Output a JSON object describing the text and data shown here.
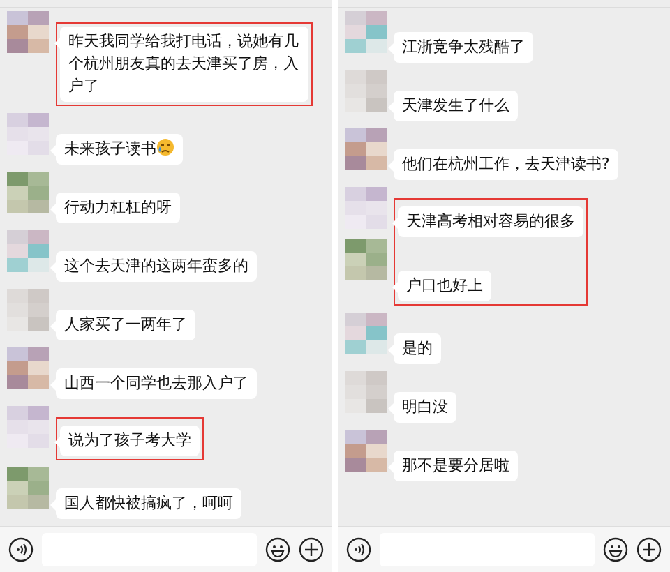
{
  "panels": [
    {
      "messages": [
        {
          "text": "昨天我同学给我打电话，说她有几个杭州朋友真的去天津买了房，入户了",
          "highlighted": true,
          "trailing_emoji": false
        },
        {
          "text": "未来孩子读书",
          "highlighted": false,
          "trailing_emoji": true
        },
        {
          "text": "行动力杠杠的呀",
          "highlighted": false,
          "trailing_emoji": false
        },
        {
          "text": "这个去天津的这两年蛮多的",
          "highlighted": false,
          "trailing_emoji": false
        },
        {
          "text": "人家买了一两年了",
          "highlighted": false,
          "trailing_emoji": false
        },
        {
          "text": "山西一个同学也去那入户了",
          "highlighted": false,
          "trailing_emoji": false
        },
        {
          "text": "说为了孩子考大学",
          "highlighted": true,
          "trailing_emoji": false
        },
        {
          "text": "国人都快被搞疯了，呵呵",
          "highlighted": false,
          "trailing_emoji": false
        }
      ]
    },
    {
      "messages": [
        {
          "text": "江浙竞争太残酷了",
          "highlighted": false,
          "trailing_emoji": false
        },
        {
          "text": "天津发生了什么",
          "highlighted": false,
          "trailing_emoji": false
        },
        {
          "text": "他们在杭州工作，去天津读书?",
          "highlighted": false,
          "trailing_emoji": false
        },
        {
          "text": "天津高考相对容易的很多",
          "highlighted": true,
          "trailing_emoji": false
        },
        {
          "text": "户口也好上",
          "highlighted": true,
          "trailing_emoji": false
        },
        {
          "text": "是的",
          "highlighted": false,
          "trailing_emoji": false
        },
        {
          "text": "明白没",
          "highlighted": false,
          "trailing_emoji": false
        },
        {
          "text": "那不是要分居啦",
          "highlighted": false,
          "trailing_emoji": false
        }
      ]
    }
  ]
}
